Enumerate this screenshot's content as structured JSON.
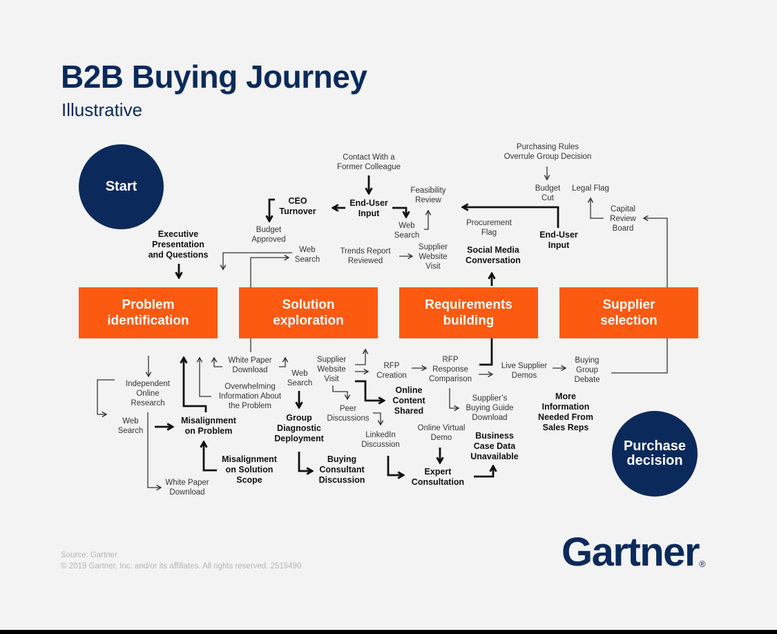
{
  "header": {
    "title": "B2B Buying Journey",
    "subtitle": "Illustrative"
  },
  "colors": {
    "navy": "#0b2a5b",
    "orange": "#fc5a11",
    "background": "#f3f3f3"
  },
  "endpoints": {
    "start": "Start",
    "end": "Purchase decision"
  },
  "stages": [
    {
      "label": "Problem identification"
    },
    {
      "label": "Solution exploration"
    },
    {
      "label": "Requirements building"
    },
    {
      "label": "Supplier selection"
    }
  ],
  "labels": {
    "contact_colleague": "Contact With a\nFormer Colleague",
    "ceo_turnover": "CEO\nTurnover",
    "end_user_input_1": "End-User\nInput",
    "feasibility_review": "Feasibility\nReview",
    "web_search_top": "Web\nSearch",
    "budget_approved": "Budget\nApproved",
    "exec_presentation": "Executive\nPresentation\nand Questions",
    "web_search_mid": "Web\nSearch",
    "trends_report": "Trends Report\nReviewed",
    "supplier_visit_top": "Supplier\nWebsite\nVisit",
    "procurement_flag": "Procurement\nFlag",
    "social_media": "Social Media\nConversation",
    "purchasing_rules": "Purchasing Rules\nOverrule Group Decision",
    "budget_cut": "Budget\nCut",
    "legal_flag": "Legal Flag",
    "capital_review": "Capital\nReview\nBoard",
    "end_user_input_2": "End-User\nInput",
    "independent_research": "Independent\nOnline\nResearch",
    "web_search_low": "Web\nSearch",
    "misalignment_problem": "Misalignment\non Problem",
    "misalignment_scope": "Misalignment\non Solution\nScope",
    "white_paper_low": "White Paper\nDownload",
    "overwhelming_info": "Overwhelming\nInformation About\nthe Problem",
    "white_paper_mid": "White Paper\nDownload",
    "web_search_b2": "Web\nSearch",
    "group_diagnostic": "Group\nDiagnostic\nDeployment",
    "buying_consultant": "Buying\nConsultant\nDiscussion",
    "supplier_visit_low": "Supplier\nWebsite\nVisit",
    "peer_discussions": "Peer\nDiscussions",
    "linkedin": "LinkedIn\nDiscussion",
    "online_content": "Online\nContent\nShared",
    "rfp_creation": "RFP\nCreation",
    "rfp_comparison": "RFP\nResponse\nComparison",
    "buying_guide": "Supplier’s\nBuying Guide\nDownload",
    "virtual_demo": "Online Virtual\nDemo",
    "expert_consultation": "Expert\nConsultation",
    "business_case": "Business\nCase Data\nUnavailable",
    "live_demos": "Live Supplier\nDemos",
    "group_debate": "Buying\nGroup\nDebate",
    "more_info": "More\nInformation\nNeeded From\nSales Reps"
  },
  "footer": {
    "source": "Source: Gartner",
    "copyright": "© 2019 Gartner, Inc. and/or its affiliates. All rights reserved. 2515490"
  },
  "logo": {
    "text": "Gartner",
    "mark": "®"
  }
}
